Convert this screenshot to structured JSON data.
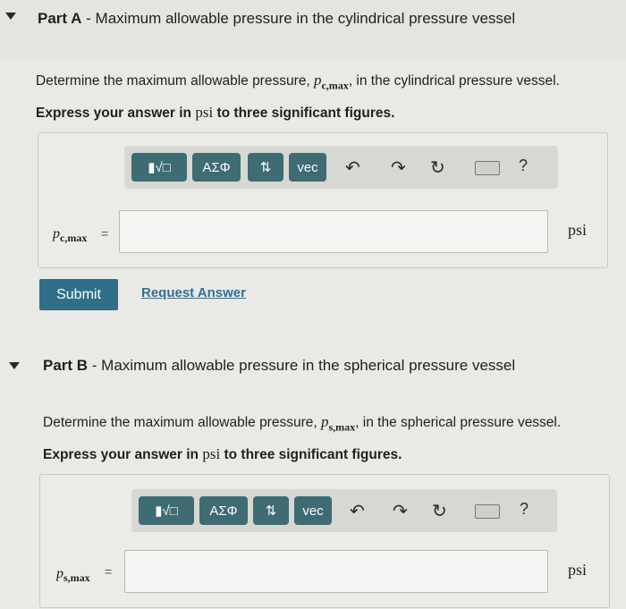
{
  "partA": {
    "title_prefix": "Part A",
    "title_rest": " - Maximum allowable pressure in the cylindrical pressure vessel",
    "prompt_before": "Determine the maximum allowable pressure, ",
    "var_main": "p",
    "var_sub": "c,max",
    "prompt_after": ", in the cylindrical pressure vessel.",
    "express_before": "Express your answer in ",
    "express_unit": "psi",
    "express_after": " to three significant figures.",
    "lhs_main": "p",
    "lhs_sub": "c,max",
    "equals": "=",
    "input_value": "",
    "unit": "psi",
    "submit_label": "Submit",
    "request_label": "Request Answer"
  },
  "partB": {
    "title_prefix": "Part B",
    "title_rest": " - Maximum allowable pressure in the spherical pressure vessel",
    "prompt_before": "Determine the maximum allowable pressure, ",
    "var_main": "p",
    "var_sub": "s,max",
    "prompt_after": ", in the spherical pressure vessel.",
    "express_before": "Express your answer in ",
    "express_unit": "psi",
    "express_after": " to three significant figures.",
    "lhs_main": "p",
    "lhs_sub": "s,max",
    "equals": "=",
    "input_value": "",
    "unit": "psi"
  },
  "toolbar": {
    "templates_glyph": "▮√□",
    "greek_label": "ΑΣΦ",
    "arrows_label": "⇅",
    "vec_label": "vec",
    "undo_glyph": "↶",
    "redo_glyph": "↷",
    "reset_glyph": "↻",
    "help_label": "?"
  },
  "colors": {
    "toolbar_button": "#3f6b73",
    "submit_button": "#2f6f8a",
    "link": "#356f8f"
  }
}
